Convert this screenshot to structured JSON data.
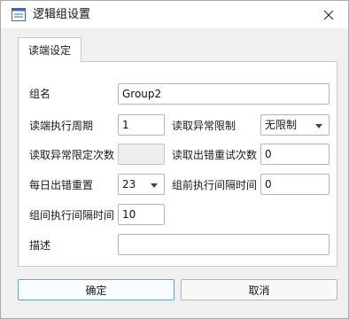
{
  "window": {
    "title": "逻辑组设置"
  },
  "tabs": [
    {
      "label": "读端设定"
    }
  ],
  "form": {
    "group_name": {
      "label": "组名",
      "value": "Group2"
    },
    "read_period": {
      "label": "读端执行周期",
      "value": "1"
    },
    "read_abnormal_limit": {
      "label": "读取异常限制",
      "value": "无限制"
    },
    "read_abnormal_limit_count": {
      "label": "读取异常限定次数",
      "value": ""
    },
    "read_error_retry": {
      "label": "读取出错重试次数",
      "value": "0"
    },
    "daily_error_reset": {
      "label": "每日出错重置",
      "value": "23"
    },
    "pre_group_interval": {
      "label": "组前执行间隔时间",
      "value": "0"
    },
    "group_interval": {
      "label": "组间执行间隔时间",
      "value": "10"
    },
    "description": {
      "label": "描述",
      "value": ""
    }
  },
  "buttons": {
    "ok": "确定",
    "cancel": "取消"
  },
  "colors": {
    "title_icon": "#2f6fc4",
    "primary_border": "#6ea0d8"
  },
  "icons": {
    "title": "window-form-icon",
    "close": "close-icon",
    "dropdown": "chevron-down-icon"
  }
}
